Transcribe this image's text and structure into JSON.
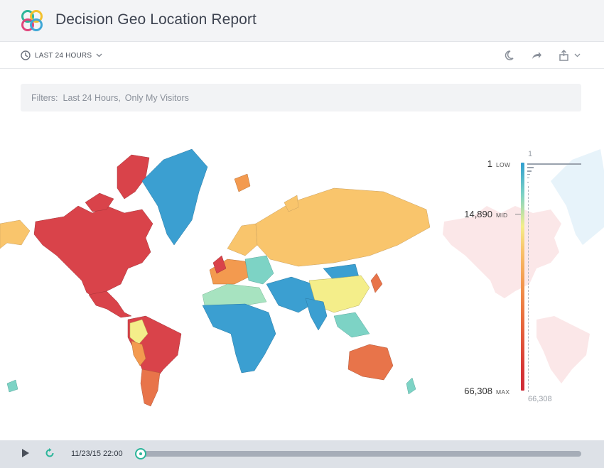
{
  "header": {
    "title": "Decision Geo Location Report",
    "logo_icon": "four-petal-logo"
  },
  "toolbar": {
    "time_range_label": "LAST 24 HOURS",
    "icons": [
      "clock-icon",
      "chevron-down-icon",
      "night-mode-icon",
      "share-icon",
      "export-icon"
    ]
  },
  "filters": {
    "title": "Filters:",
    "values": [
      "Last 24 Hours,",
      "Only My Visitors"
    ]
  },
  "legend": {
    "low_value": "1",
    "low_tag": "LOW",
    "mid_value": "14,890",
    "mid_tag": "MID",
    "max_value": "66,308",
    "max_tag": "MAX",
    "hist_top": "1",
    "hist_bottom": "66,308",
    "colors": {
      "low": "#2f9fd0",
      "mid": "#f4ee8a",
      "high": "#cf2c38"
    }
  },
  "playback": {
    "timestamp": "11/23/15 22:00",
    "progress": 0,
    "accent": "#2cb59a"
  }
}
